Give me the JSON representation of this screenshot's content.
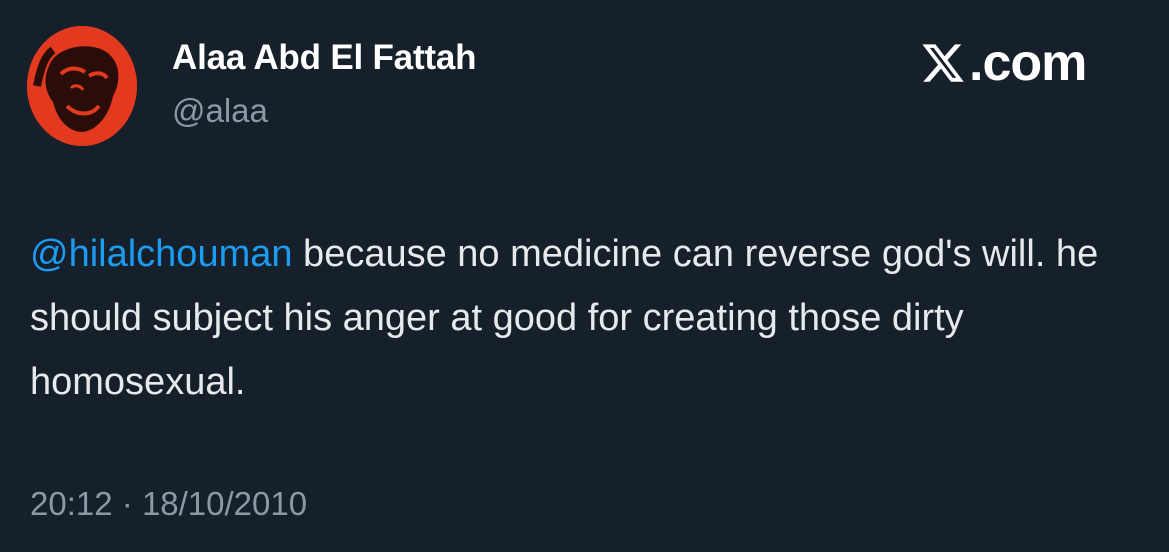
{
  "author": {
    "display_name": "Alaa Abd El Fattah",
    "handle": "@alaa",
    "avatar_icon": "profile-portrait-avatar",
    "avatar_color": "#e2391f"
  },
  "brand": {
    "label": ".com",
    "icon": "x-logo-icon"
  },
  "tweet": {
    "mention": "@hilalchouman",
    "text": " because no medicine can reverse god's will. he should subject his anger at good for creating those dirty homosexual.",
    "time": "20:12",
    "separator": "·",
    "date": "18/10/2010"
  },
  "colors": {
    "background": "#15202b",
    "mention": "#1d9bf0",
    "secondary": "#8b98a5"
  }
}
